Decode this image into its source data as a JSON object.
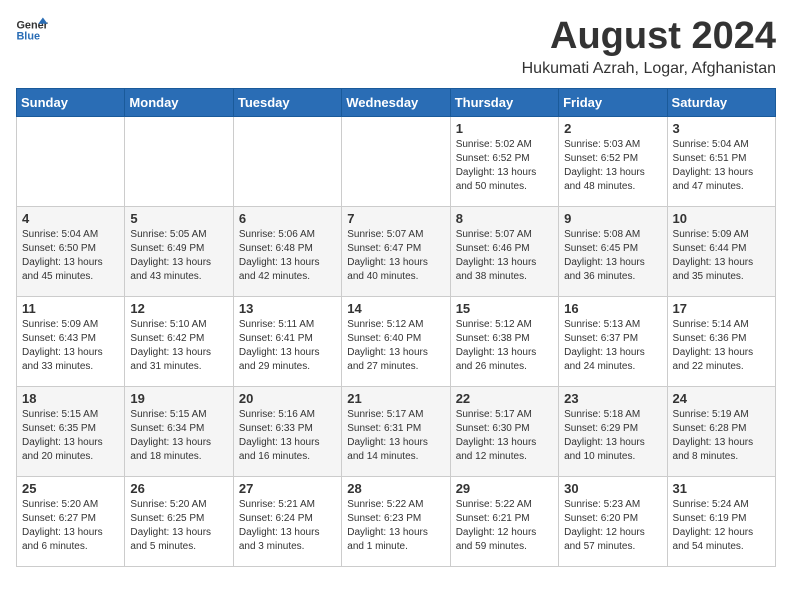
{
  "logo": {
    "general": "General",
    "blue": "Blue"
  },
  "title": "August 2024",
  "subtitle": "Hukumati Azrah, Logar, Afghanistan",
  "weekdays": [
    "Sunday",
    "Monday",
    "Tuesday",
    "Wednesday",
    "Thursday",
    "Friday",
    "Saturday"
  ],
  "weeks": [
    [
      {
        "day": "",
        "info": ""
      },
      {
        "day": "",
        "info": ""
      },
      {
        "day": "",
        "info": ""
      },
      {
        "day": "",
        "info": ""
      },
      {
        "day": "1",
        "info": "Sunrise: 5:02 AM\nSunset: 6:52 PM\nDaylight: 13 hours\nand 50 minutes."
      },
      {
        "day": "2",
        "info": "Sunrise: 5:03 AM\nSunset: 6:52 PM\nDaylight: 13 hours\nand 48 minutes."
      },
      {
        "day": "3",
        "info": "Sunrise: 5:04 AM\nSunset: 6:51 PM\nDaylight: 13 hours\nand 47 minutes."
      }
    ],
    [
      {
        "day": "4",
        "info": "Sunrise: 5:04 AM\nSunset: 6:50 PM\nDaylight: 13 hours\nand 45 minutes."
      },
      {
        "day": "5",
        "info": "Sunrise: 5:05 AM\nSunset: 6:49 PM\nDaylight: 13 hours\nand 43 minutes."
      },
      {
        "day": "6",
        "info": "Sunrise: 5:06 AM\nSunset: 6:48 PM\nDaylight: 13 hours\nand 42 minutes."
      },
      {
        "day": "7",
        "info": "Sunrise: 5:07 AM\nSunset: 6:47 PM\nDaylight: 13 hours\nand 40 minutes."
      },
      {
        "day": "8",
        "info": "Sunrise: 5:07 AM\nSunset: 6:46 PM\nDaylight: 13 hours\nand 38 minutes."
      },
      {
        "day": "9",
        "info": "Sunrise: 5:08 AM\nSunset: 6:45 PM\nDaylight: 13 hours\nand 36 minutes."
      },
      {
        "day": "10",
        "info": "Sunrise: 5:09 AM\nSunset: 6:44 PM\nDaylight: 13 hours\nand 35 minutes."
      }
    ],
    [
      {
        "day": "11",
        "info": "Sunrise: 5:09 AM\nSunset: 6:43 PM\nDaylight: 13 hours\nand 33 minutes."
      },
      {
        "day": "12",
        "info": "Sunrise: 5:10 AM\nSunset: 6:42 PM\nDaylight: 13 hours\nand 31 minutes."
      },
      {
        "day": "13",
        "info": "Sunrise: 5:11 AM\nSunset: 6:41 PM\nDaylight: 13 hours\nand 29 minutes."
      },
      {
        "day": "14",
        "info": "Sunrise: 5:12 AM\nSunset: 6:40 PM\nDaylight: 13 hours\nand 27 minutes."
      },
      {
        "day": "15",
        "info": "Sunrise: 5:12 AM\nSunset: 6:38 PM\nDaylight: 13 hours\nand 26 minutes."
      },
      {
        "day": "16",
        "info": "Sunrise: 5:13 AM\nSunset: 6:37 PM\nDaylight: 13 hours\nand 24 minutes."
      },
      {
        "day": "17",
        "info": "Sunrise: 5:14 AM\nSunset: 6:36 PM\nDaylight: 13 hours\nand 22 minutes."
      }
    ],
    [
      {
        "day": "18",
        "info": "Sunrise: 5:15 AM\nSunset: 6:35 PM\nDaylight: 13 hours\nand 20 minutes."
      },
      {
        "day": "19",
        "info": "Sunrise: 5:15 AM\nSunset: 6:34 PM\nDaylight: 13 hours\nand 18 minutes."
      },
      {
        "day": "20",
        "info": "Sunrise: 5:16 AM\nSunset: 6:33 PM\nDaylight: 13 hours\nand 16 minutes."
      },
      {
        "day": "21",
        "info": "Sunrise: 5:17 AM\nSunset: 6:31 PM\nDaylight: 13 hours\nand 14 minutes."
      },
      {
        "day": "22",
        "info": "Sunrise: 5:17 AM\nSunset: 6:30 PM\nDaylight: 13 hours\nand 12 minutes."
      },
      {
        "day": "23",
        "info": "Sunrise: 5:18 AM\nSunset: 6:29 PM\nDaylight: 13 hours\nand 10 minutes."
      },
      {
        "day": "24",
        "info": "Sunrise: 5:19 AM\nSunset: 6:28 PM\nDaylight: 13 hours\nand 8 minutes."
      }
    ],
    [
      {
        "day": "25",
        "info": "Sunrise: 5:20 AM\nSunset: 6:27 PM\nDaylight: 13 hours\nand 6 minutes."
      },
      {
        "day": "26",
        "info": "Sunrise: 5:20 AM\nSunset: 6:25 PM\nDaylight: 13 hours\nand 5 minutes."
      },
      {
        "day": "27",
        "info": "Sunrise: 5:21 AM\nSunset: 6:24 PM\nDaylight: 13 hours\nand 3 minutes."
      },
      {
        "day": "28",
        "info": "Sunrise: 5:22 AM\nSunset: 6:23 PM\nDaylight: 13 hours\nand 1 minute."
      },
      {
        "day": "29",
        "info": "Sunrise: 5:22 AM\nSunset: 6:21 PM\nDaylight: 12 hours\nand 59 minutes."
      },
      {
        "day": "30",
        "info": "Sunrise: 5:23 AM\nSunset: 6:20 PM\nDaylight: 12 hours\nand 57 minutes."
      },
      {
        "day": "31",
        "info": "Sunrise: 5:24 AM\nSunset: 6:19 PM\nDaylight: 12 hours\nand 54 minutes."
      }
    ]
  ]
}
